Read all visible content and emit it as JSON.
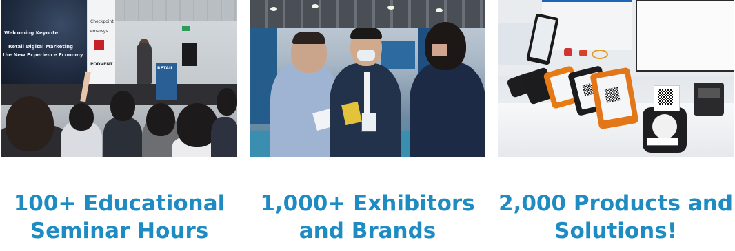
{
  "columns": [
    {
      "caption_line1": "100+ Educational",
      "caption_line2": "Seminar Hours",
      "photo": {
        "screen_title": "Welcoming Keynote",
        "screen_line1": "Retail Digital Marketing",
        "screen_line2": "the New Experience Economy",
        "podium_label": "RETAIL",
        "sponsors": [
          "Checkpoint",
          "emarsys",
          "PODVENT"
        ]
      }
    },
    {
      "caption_line1": "1,000+ Exhibitors",
      "caption_line2": "and Brands"
    },
    {
      "caption_line1": "2,000 Products and",
      "caption_line2": "Solutions!"
    }
  ],
  "colors": {
    "caption": "#1e8bc3",
    "background": "#ffffff"
  }
}
